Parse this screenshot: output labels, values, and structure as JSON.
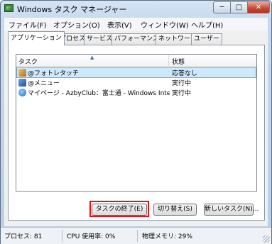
{
  "window": {
    "title": "Windows タスク マネージャー",
    "min_symbol": "─",
    "max_symbol": "□",
    "close_symbol": "✕"
  },
  "menu": [
    "ファイル(F)",
    "オプション(O)",
    "表示(V)",
    "ウィンドウ(W)",
    "ヘルプ(H)"
  ],
  "tabs": [
    "アプリケーション",
    "プロセス",
    "サービス",
    "パフォーマンス",
    "ネットワーク",
    "ユーザー"
  ],
  "active_tab": "アプリケーション",
  "columns": {
    "task": "タスク",
    "status": "状態"
  },
  "rows": [
    {
      "name": "@フォトレタッチ",
      "status": "応答なし",
      "icon": "photo-retouch-icon",
      "selected": true
    },
    {
      "name": "@メニュー",
      "status": "実行中",
      "icon": "menu-app-icon",
      "selected": false
    },
    {
      "name": "マイページ - AzbyClub：富士通 - Windows Inte...",
      "status": "実行中",
      "icon": "internet-explorer-icon",
      "selected": false
    }
  ],
  "buttons": {
    "end_task": "タスクの終了(E)",
    "switch_to": "切り替え(S)",
    "new_task": "新しいタスク(N)..."
  },
  "status_bar": {
    "processes": "プロセス: 81",
    "cpu": "CPU 使用率: 0%",
    "memory": "物理メモリ: 29%"
  },
  "colors": {
    "highlight_box": "#e8101a",
    "selected_row": "#cde8ff"
  }
}
